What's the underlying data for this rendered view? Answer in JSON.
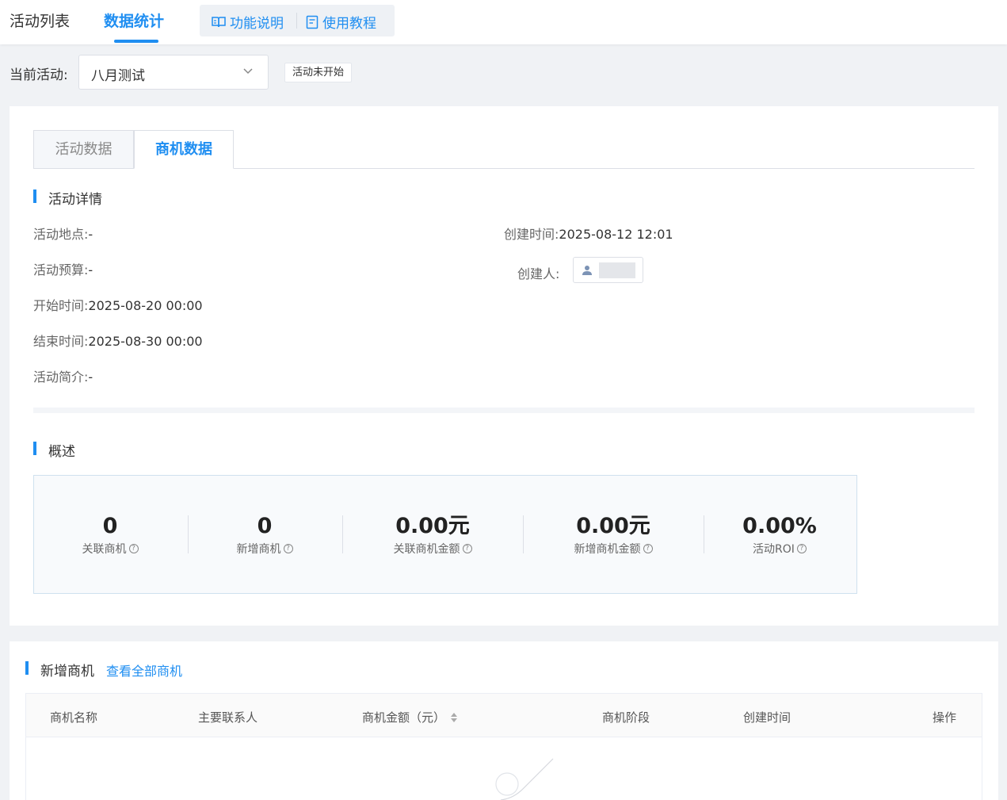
{
  "topnav": {
    "tabs": [
      {
        "label": "活动列表",
        "active": false
      },
      {
        "label": "数据统计",
        "active": true
      }
    ],
    "help": [
      {
        "label": "功能说明",
        "icon": "book-open-icon"
      },
      {
        "label": "使用教程",
        "icon": "document-icon"
      }
    ]
  },
  "activity": {
    "label": "当前活动:",
    "selected": "八月测试",
    "status": "活动未开始"
  },
  "panel_tabs": [
    {
      "label": "活动数据",
      "active": false
    },
    {
      "label": "商机数据",
      "active": true
    }
  ],
  "details": {
    "title": "活动详情",
    "location": {
      "key": "活动地点:",
      "value": "-"
    },
    "budget": {
      "key": "活动预算:",
      "value": "-"
    },
    "start": {
      "key": "开始时间:",
      "value": "2025-08-20 00:00"
    },
    "end": {
      "key": "结束时间:",
      "value": "2025-08-30 00:00"
    },
    "intro": {
      "key": "活动简介:",
      "value": "-"
    },
    "created": {
      "key": "创建时间:",
      "value": "2025-08-12 12:01"
    },
    "creator": {
      "key": "创建人:"
    }
  },
  "overview": {
    "title": "概述",
    "stats": [
      {
        "value": "0",
        "label": "关联商机"
      },
      {
        "value": "0",
        "label": "新增商机"
      },
      {
        "value": "0.00元",
        "label": "关联商机金额"
      },
      {
        "value": "0.00元",
        "label": "新增商机金额"
      },
      {
        "value": "0.00%",
        "label": "活动ROI"
      }
    ],
    "help_mark": "?"
  },
  "new_opps": {
    "title": "新增商机",
    "link": "查看全部商机",
    "columns": [
      "商机名称",
      "主要联系人",
      "商机金额（元）",
      "商机阶段",
      "创建时间",
      "操作"
    ]
  },
  "colors": {
    "accent": "#1f8ef1",
    "background": "#f0f2f5"
  }
}
